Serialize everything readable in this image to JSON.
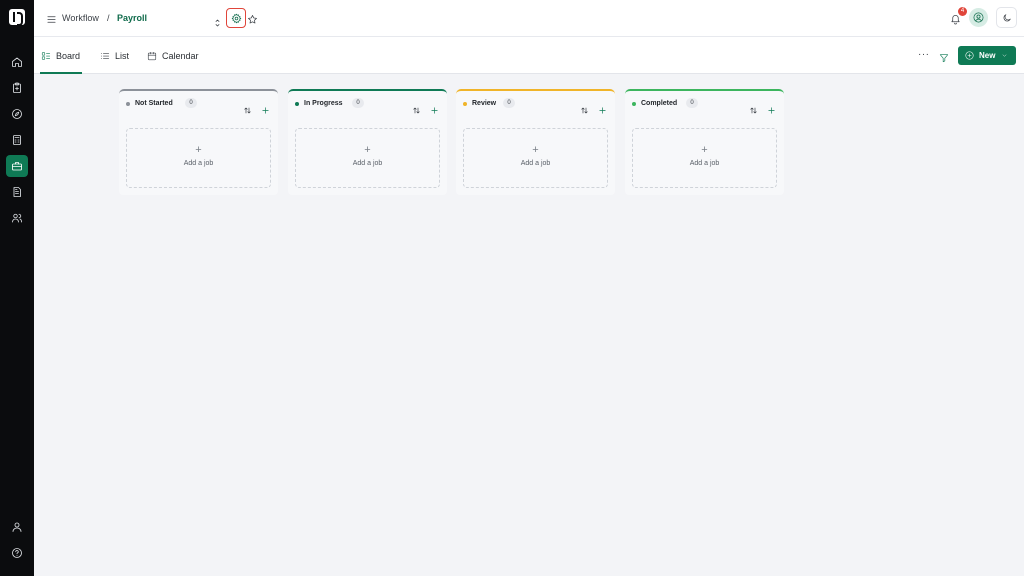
{
  "sidebar": {
    "logo": "logo-icon",
    "items": [
      {
        "name": "home",
        "icon": "home-icon",
        "active": false
      },
      {
        "name": "clipboard",
        "icon": "clipboard-icon",
        "active": false
      },
      {
        "name": "compass",
        "icon": "compass-icon",
        "active": false
      },
      {
        "name": "calculator",
        "icon": "calculator-icon",
        "active": false
      },
      {
        "name": "briefcase",
        "icon": "briefcase-icon",
        "active": true
      },
      {
        "name": "document",
        "icon": "document-icon",
        "active": false
      },
      {
        "name": "users",
        "icon": "users-icon",
        "active": false
      }
    ],
    "bottom": [
      {
        "name": "profile",
        "icon": "user-icon"
      },
      {
        "name": "help",
        "icon": "help-icon"
      }
    ]
  },
  "header": {
    "breadcrumb_root": "Workflow",
    "breadcrumb_sep": "/",
    "breadcrumb_current": "Payroll",
    "notification_count": "4"
  },
  "views": {
    "tabs": [
      {
        "label": "Board",
        "icon": "board-icon",
        "active": true
      },
      {
        "label": "List",
        "icon": "list-icon",
        "active": false
      },
      {
        "label": "Calendar",
        "icon": "calendar-icon",
        "active": false
      }
    ],
    "more_label": "···",
    "new_label": "New"
  },
  "board": {
    "add_label": "Add a job",
    "add_symbol": "+",
    "columns": [
      {
        "title": "Not Started",
        "count": "0",
        "color": "#8c9199"
      },
      {
        "title": "In Progress",
        "count": "0",
        "color": "#0f7a55"
      },
      {
        "title": "Review",
        "count": "0",
        "color": "#f0b429"
      },
      {
        "title": "Completed",
        "count": "0",
        "color": "#3cb55e"
      }
    ]
  },
  "colors": {
    "accent": "#0f7a55",
    "danger": "#e0453a"
  }
}
